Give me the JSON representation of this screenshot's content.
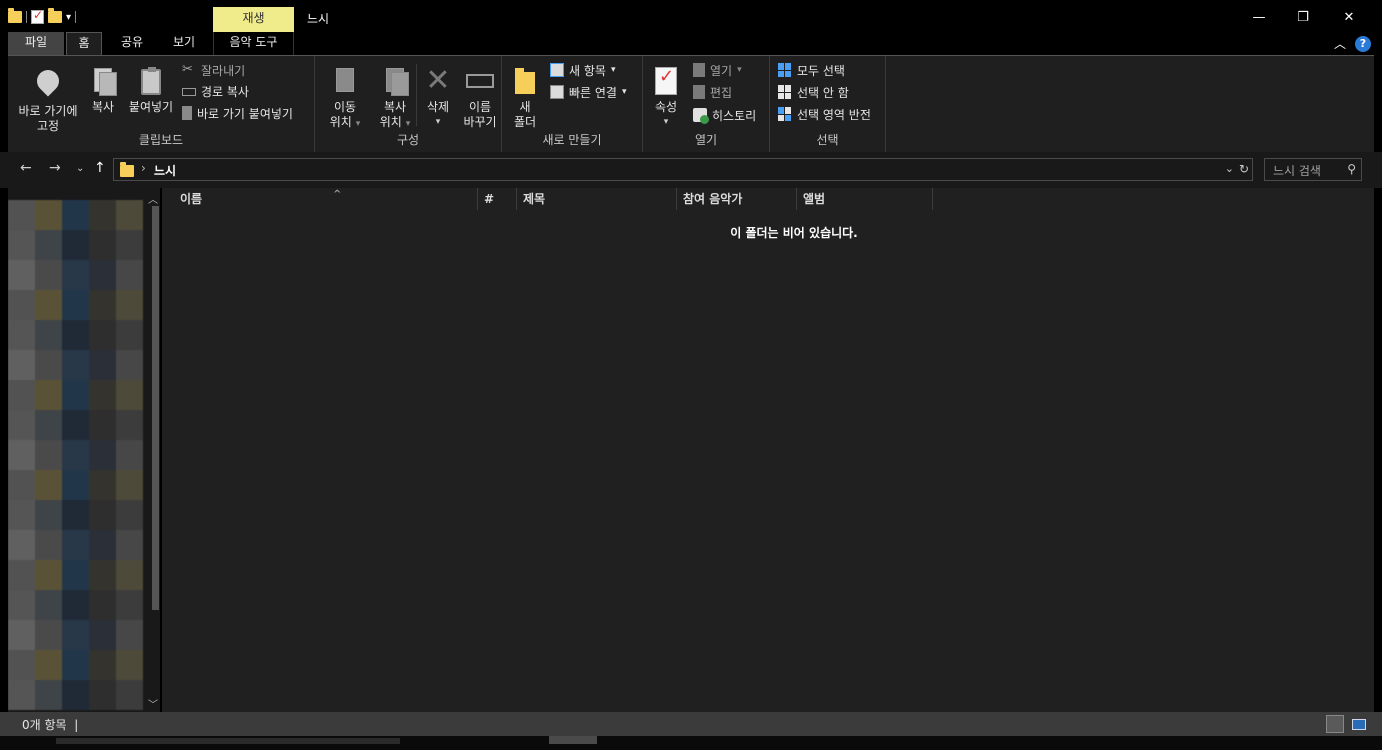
{
  "window": {
    "title": "느시",
    "context_tab": "재생",
    "controls": {
      "minimize": "—",
      "restore": "❐",
      "close": "✕"
    }
  },
  "tabs": [
    {
      "id": "file",
      "label": "파일"
    },
    {
      "id": "home",
      "label": "홈"
    },
    {
      "id": "share",
      "label": "공유"
    },
    {
      "id": "view",
      "label": "보기"
    },
    {
      "id": "music",
      "label": "음악 도구"
    }
  ],
  "ribbon": {
    "clipboard": {
      "label": "클립보드",
      "pin_line1": "바로 가기에",
      "pin_line2": "고정",
      "copy": "복사",
      "paste": "붙여넣기",
      "cut": "잘라내기",
      "copy_path": "경로 복사",
      "paste_shortcut": "바로 가기 붙여넣기"
    },
    "organize": {
      "label": "구성",
      "move_line1": "이동",
      "move_line2": "위치",
      "copyto_line1": "복사",
      "copyto_line2": "위치",
      "delete": "삭제",
      "rename_line1": "이름",
      "rename_line2": "바꾸기"
    },
    "new": {
      "label": "새로 만들기",
      "new_folder_line1": "새",
      "new_folder_line2": "폴더",
      "new_item": "새 항목",
      "easy_access": "빠른 연결"
    },
    "open": {
      "label": "열기",
      "properties": "속성",
      "open": "열기",
      "edit": "편집",
      "history": "히스토리"
    },
    "select": {
      "label": "선택",
      "select_all": "모두 선택",
      "select_none": "선택 안 함",
      "invert": "선택 영역 반전"
    }
  },
  "address": {
    "path": "느시",
    "search_placeholder": "느시 검색"
  },
  "columns": [
    {
      "label": "이름"
    },
    {
      "label": "#"
    },
    {
      "label": "제목"
    },
    {
      "label": "참여 음악가"
    },
    {
      "label": "앨범"
    }
  ],
  "content": {
    "empty_message": "이 폴더는 비어 있습니다."
  },
  "status": {
    "item_count": "0개 항목"
  },
  "colors": {
    "context_tab_bg": "#f0ec8c",
    "ribbon_bg": "#1f1f1f",
    "content_bg": "#202020",
    "folder": "#f5cf5a",
    "accent_blue": "#4a9ff5"
  }
}
